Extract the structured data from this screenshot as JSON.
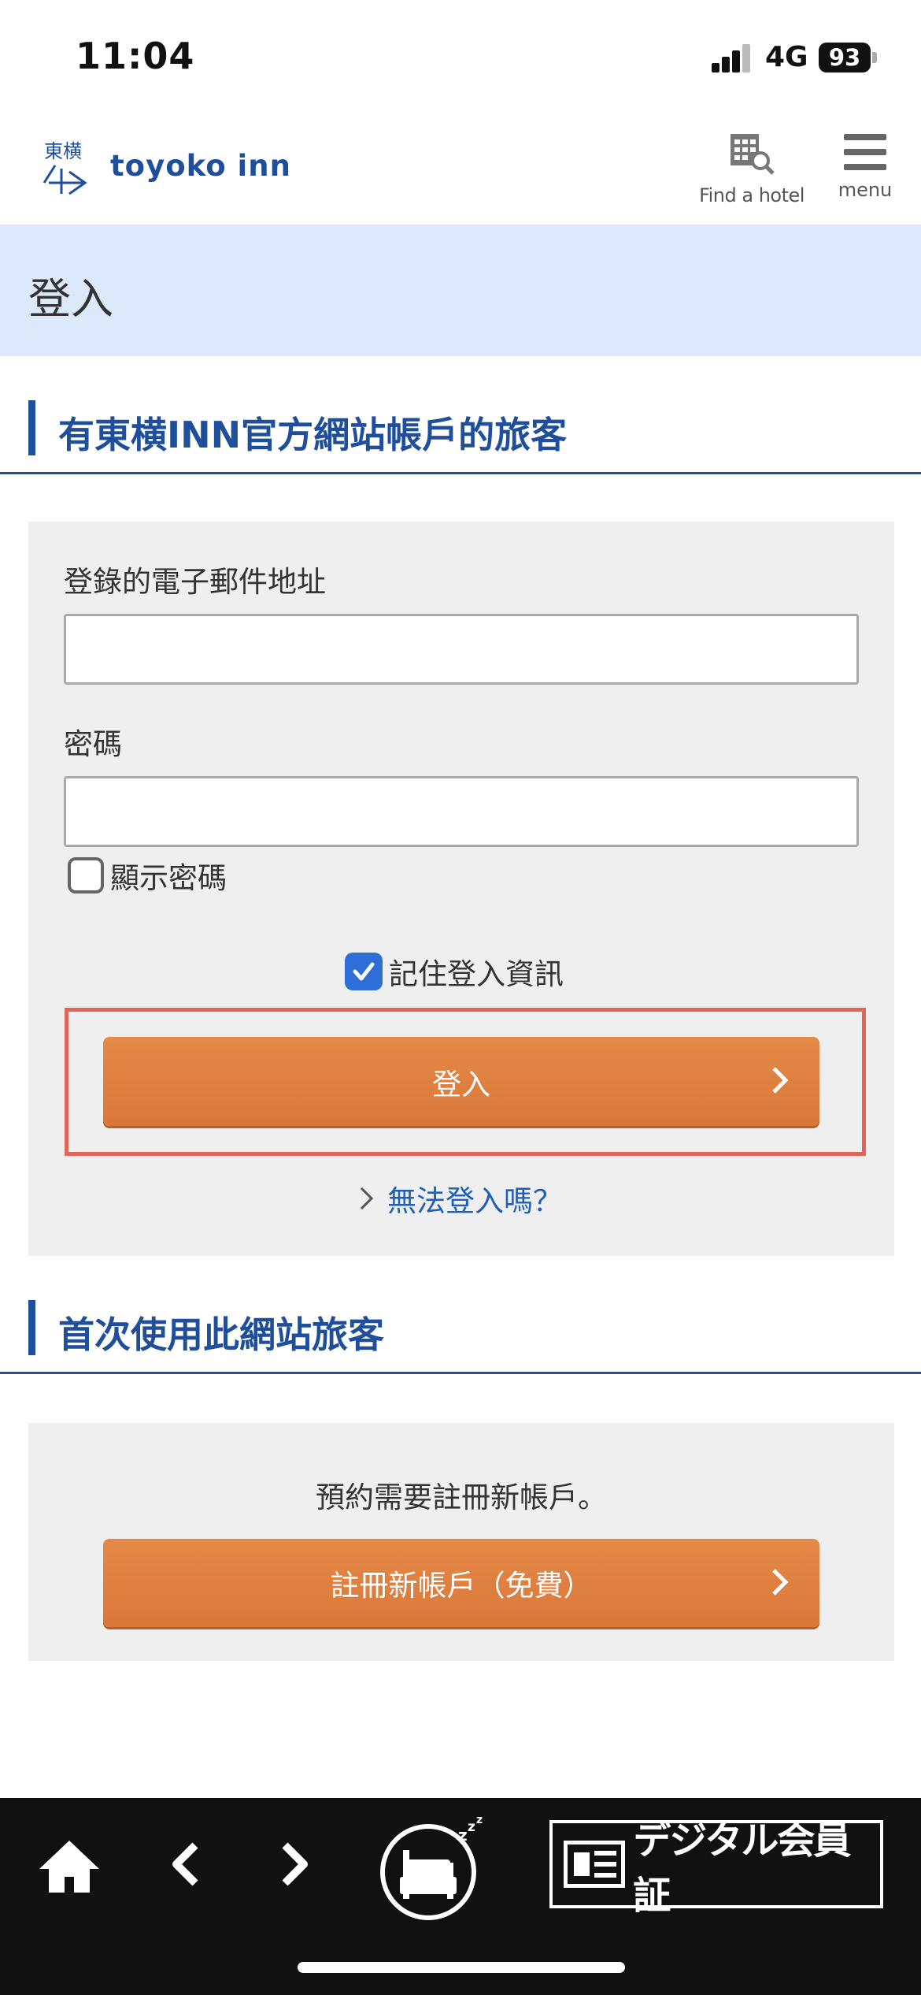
{
  "status_bar": {
    "time": "11:04",
    "network": "4G",
    "battery": "93"
  },
  "header": {
    "logo_text": "toyoko inn",
    "find_hotel_label": "Find a hotel",
    "menu_label": "menu"
  },
  "page": {
    "title": "登入"
  },
  "member_section": {
    "heading": "有東横INN官方網站帳戶的旅客",
    "email_label": "登錄的電子郵件地址",
    "email_value": "",
    "password_label": "密碼",
    "password_value": "",
    "show_password_label": "顯示密碼",
    "show_password_checked": false,
    "remember_label": "記住登入資訊",
    "remember_checked": true,
    "login_button": "登入",
    "forgot_link": "無法登入嗎？"
  },
  "new_section": {
    "heading": "首次使用此網站旅客",
    "notice": "預約需要註冊新帳戶。",
    "register_button": "註冊新帳戶（免費）"
  },
  "bottom_bar": {
    "digital_card_label": "デジタル会員証",
    "icons": [
      "home-icon",
      "back-icon",
      "forward-icon",
      "bed-icon",
      "member-card-icon"
    ]
  },
  "colors": {
    "brand_blue": "#1f4e9a",
    "title_band": "#dbe9fb",
    "button_orange": "#e0803f",
    "highlight_red": "#e0665c",
    "checkbox_blue": "#2d6fd6"
  }
}
